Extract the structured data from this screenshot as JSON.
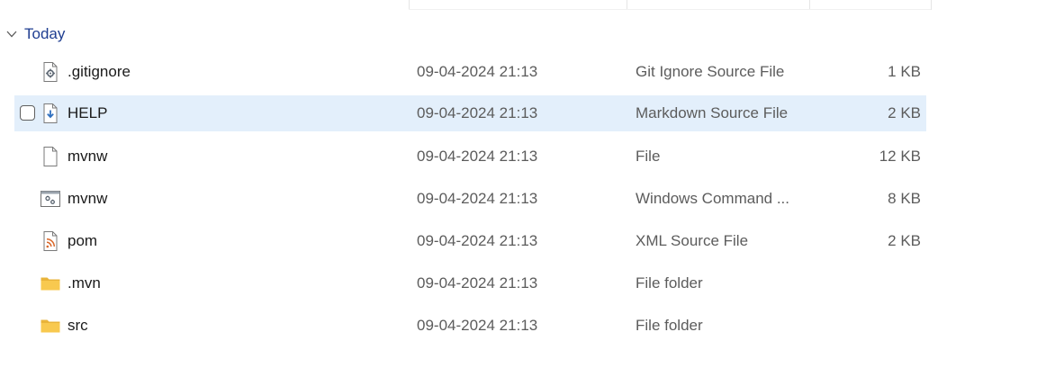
{
  "group": {
    "label": "Today"
  },
  "files": [
    {
      "name": ".gitignore",
      "date": "09-04-2024 21:13",
      "type": "Git Ignore Source File",
      "size": "1 KB",
      "icon": "gear-file-icon",
      "selected": false
    },
    {
      "name": "HELP",
      "date": "09-04-2024 21:13",
      "type": "Markdown Source File",
      "size": "2 KB",
      "icon": "markdown-file-icon",
      "selected": true
    },
    {
      "name": "mvnw",
      "date": "09-04-2024 21:13",
      "type": "File",
      "size": "12 KB",
      "icon": "blank-file-icon",
      "selected": false
    },
    {
      "name": "mvnw",
      "date": "09-04-2024 21:13",
      "type": "Windows Command ...",
      "size": "8 KB",
      "icon": "command-script-icon",
      "selected": false
    },
    {
      "name": "pom",
      "date": "09-04-2024 21:13",
      "type": "XML Source File",
      "size": "2 KB",
      "icon": "rss-xml-file-icon",
      "selected": false
    },
    {
      "name": ".mvn",
      "date": "09-04-2024 21:13",
      "type": "File folder",
      "size": "",
      "icon": "folder-icon",
      "selected": false
    },
    {
      "name": "src",
      "date": "09-04-2024 21:13",
      "type": "File folder",
      "size": "",
      "icon": "folder-icon",
      "selected": false
    }
  ],
  "colors": {
    "selection": "#e3effb",
    "group_label": "#1f3e91",
    "secondary_text": "#5c5c5c",
    "folder": "#f8c94f"
  }
}
